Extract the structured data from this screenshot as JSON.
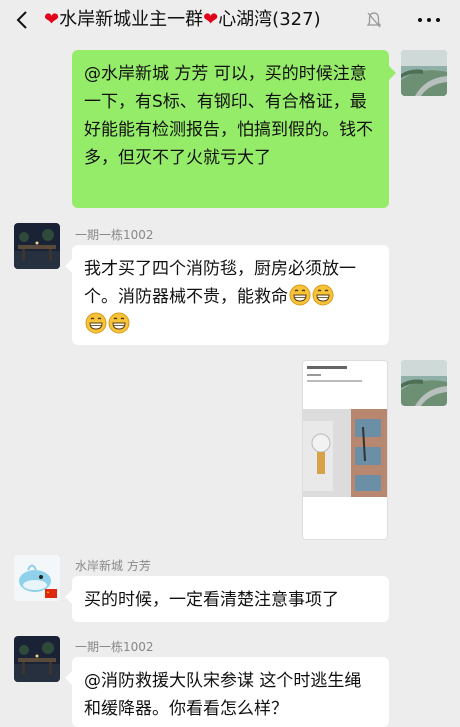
{
  "header": {
    "back_icon": "chevron-left-icon",
    "title_part1": "水岸新城业主一群",
    "title_part2": "心湖湾(327)",
    "mute_icon": "bell-muted-icon",
    "more_icon": "more-dots-icon"
  },
  "messages": [
    {
      "side": "right",
      "text": "@水岸新城 方芳 可以，买的时候注意一下，有S标、有钢印、有合格证，最好能能有检测报告，怕搞到假的。钱不多，但灭不了火就亏大了"
    },
    {
      "side": "left",
      "sender": "一期一栋1002",
      "text": "我才买了四个消防毯，厨房必须放一个。消防器械不贵，能救命",
      "emoji": "grinning-face-icon",
      "emoji_count": 4
    },
    {
      "side": "right",
      "type": "image",
      "image_icon": "screenshot-photo-icon"
    },
    {
      "side": "left",
      "sender": "水岸新城 方芳",
      "text": "买的时候，一定看清楚注意事项了"
    },
    {
      "side": "left",
      "sender": "一期一栋1002",
      "text": "@消防救援大队宋参谋 这个时逃生绳和缓降器。你看看怎么样？"
    }
  ],
  "colors": {
    "background": "#ededed",
    "my_bubble": "#95ec69",
    "other_bubble": "#ffffff",
    "heart": "#e3001b",
    "nickname": "#888888"
  }
}
